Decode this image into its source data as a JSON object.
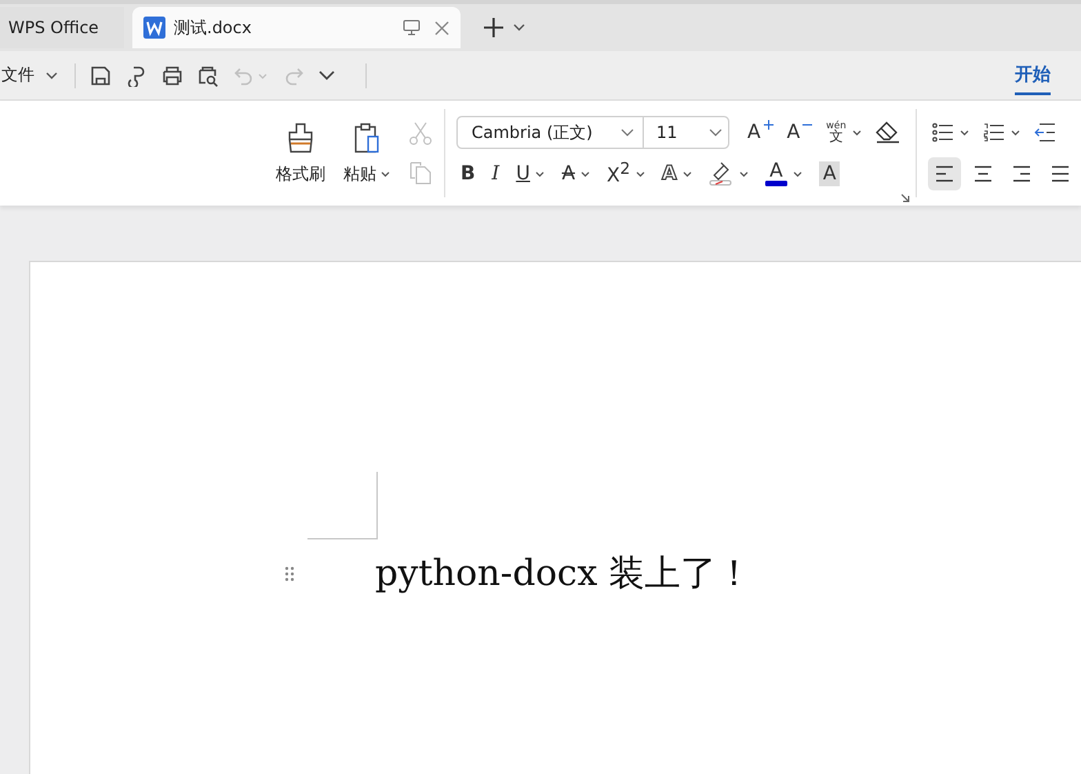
{
  "tabs": [
    {
      "label": "WPS Office",
      "kind": "home",
      "selected": false
    },
    {
      "label": "测试.docx",
      "kind": "doc",
      "selected": true
    }
  ],
  "quick_access": {
    "file_menu": "文件",
    "undo_disabled": true,
    "redo_disabled": true
  },
  "ribbon_tabs": [
    {
      "label": "开始",
      "selected": true
    }
  ],
  "clipboard": {
    "format_painter": "格式刷",
    "paste": "粘贴",
    "cut_disabled": true,
    "copy_disabled": true
  },
  "font": {
    "family": "Cambria (正文)",
    "size": "11"
  },
  "font_row1": [
    {
      "kind": "grow",
      "glyph": "A"
    },
    {
      "kind": "shrink",
      "glyph": "A"
    },
    {
      "kind": "pinyin",
      "glyph": "文",
      "top": "wén"
    },
    {
      "kind": "eraser"
    }
  ],
  "font_row2": [
    {
      "kind": "bold",
      "glyph": "B"
    },
    {
      "kind": "italic",
      "glyph": "I"
    },
    {
      "kind": "underline",
      "glyph": "U"
    },
    {
      "kind": "strike",
      "glyph": "A"
    },
    {
      "kind": "super",
      "glyph": "X$^{2}$"
    },
    {
      "kind": "effect",
      "glyph": "A"
    },
    {
      "kind": "highlight"
    },
    {
      "kind": "color",
      "glyph": "A",
      "color": "#0000cc"
    },
    {
      "kind": "shade",
      "glyph": "A"
    }
  ],
  "paragraph_row1": [
    {
      "kind": "bullets"
    },
    {
      "kind": "numbering"
    },
    {
      "kind": "outdent"
    }
  ],
  "alignment": [
    {
      "kind": "left",
      "selected": true
    },
    {
      "kind": "center",
      "selected": false
    },
    {
      "kind": "right",
      "selected": false
    },
    {
      "kind": "justify",
      "selected": false
    }
  ],
  "document": {
    "text": "python-docx 装上了！"
  }
}
